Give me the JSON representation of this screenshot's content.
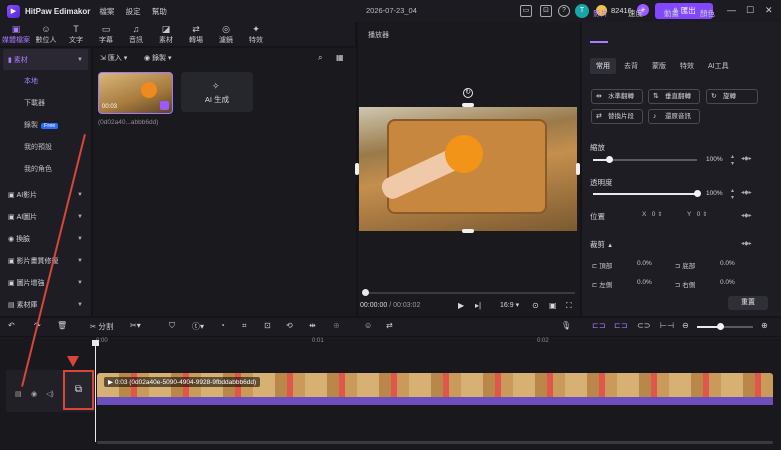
{
  "app": {
    "name": "HitPaw Edimakor",
    "date": "2026-07-23_04",
    "coins": "82416",
    "export_label": "匯出",
    "avatar_letter": "T"
  },
  "menu": [
    "檔案",
    "設定",
    "幫助"
  ],
  "top_tabs": [
    {
      "label": "媒體檔案",
      "icon": "folder-icon",
      "glyph": "▣"
    },
    {
      "label": "數位人",
      "icon": "person-icon",
      "glyph": "☺"
    },
    {
      "label": "文字",
      "icon": "text-icon",
      "glyph": "T"
    },
    {
      "label": "字幕",
      "icon": "subtitle-icon",
      "glyph": "▭"
    },
    {
      "label": "音訊",
      "icon": "music-icon",
      "glyph": "♫"
    },
    {
      "label": "素材",
      "icon": "sticker-icon",
      "glyph": "◪"
    },
    {
      "label": "轉場",
      "icon": "transition-icon",
      "glyph": "⇄"
    },
    {
      "label": "濾鏡",
      "icon": "filter-icon",
      "glyph": "◎"
    },
    {
      "label": "特效",
      "icon": "effects-icon",
      "glyph": "✦"
    }
  ],
  "left_panel": {
    "categories": [
      {
        "label": "素材",
        "active": true
      },
      {
        "label": "AI影片"
      },
      {
        "label": "AI圖片"
      },
      {
        "label": "換臉"
      },
      {
        "label": "影片畫質修復"
      },
      {
        "label": "圖片增強"
      },
      {
        "label": "素材庫"
      }
    ],
    "sub_items": [
      {
        "label": "本地",
        "active": true
      },
      {
        "label": "下載器"
      },
      {
        "label": "錄製",
        "badge": "Free"
      },
      {
        "label": "我的預設"
      },
      {
        "label": "我的角色"
      }
    ]
  },
  "media": {
    "import_label": "匯入",
    "record_label": "錄製",
    "thumb_duration": "00:03",
    "thumb_name": "(0d02a40...abbb6dd)",
    "ai_generate_label": "AI 生成"
  },
  "player": {
    "title": "播放器",
    "current_time": "00:00:00",
    "total_time": "/ 00:03:02",
    "aspect": "16:9"
  },
  "right_panel": {
    "tabs": [
      "影片",
      "速度",
      "動畫",
      "顏色"
    ],
    "sub_tabs": [
      "常用",
      "去背",
      "蒙版",
      "特效",
      "AI工具"
    ],
    "buttons": [
      "水準翻轉",
      "垂直翻轉",
      "旋轉",
      "替換片段",
      "還原音訊"
    ],
    "scale_label": "縮放",
    "scale_value": "100%",
    "scale": 0.15,
    "opacity_label": "透明度",
    "opacity_value": "100%",
    "opacity": 1.0,
    "position_label": "位置",
    "pos_x_label": "X",
    "pos_x_value": "0",
    "pos_y_label": "Y",
    "pos_y_value": "0",
    "crop_label": "裁剪",
    "crop": [
      {
        "label": "頂部",
        "value": "0.0%"
      },
      {
        "label": "底部",
        "value": "0.0%"
      },
      {
        "label": "左側",
        "value": "0.0%"
      },
      {
        "label": "右側",
        "value": "0.0%"
      }
    ],
    "reset_label": "重置"
  },
  "toolbar": {
    "split_label": "分割"
  },
  "timeline": {
    "ruler_marks": [
      "0:00",
      "0:01",
      "0:02"
    ],
    "clip_label": "0:03  (0d02a40e-5090-4904-9928-9fbddabbb6dd)"
  },
  "colors": {
    "accent": "#a97bff",
    "export": "#8247ff",
    "annotation": "#d8453a"
  }
}
